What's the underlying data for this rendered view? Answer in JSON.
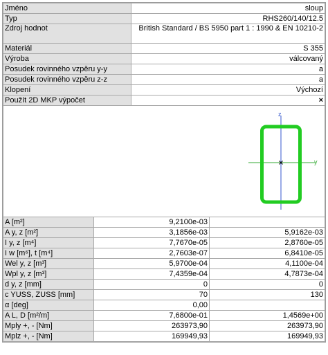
{
  "properties": [
    {
      "label": "Jméno",
      "value": "sloup"
    },
    {
      "label": "Typ",
      "value": "RHS260/140/12.5"
    },
    {
      "label": "Zdroj hodnot",
      "value": "British Standard / BS 5950 part 1 : 1990 & EN 10210-2"
    },
    {
      "label": "Materiál",
      "value": "S 355"
    },
    {
      "label": "Výroba",
      "value": "válcovaný"
    },
    {
      "label": "Posudek rovinného vzpěru y-y",
      "value": "a"
    },
    {
      "label": "Posudek rovinného vzpěru z-z",
      "value": "a"
    },
    {
      "label": "Klopení",
      "value": "Výchozí"
    },
    {
      "label": "Použít 2D MKP výpočet",
      "value": "×"
    }
  ],
  "figure": {
    "z_axis": "z",
    "y_axis": "y",
    "section_color": "#22cc22",
    "axis_color": "#33aa33",
    "z_axis_color": "#3355cc"
  },
  "table": [
    {
      "label": "A [m²]",
      "v1": "9,2100e-03",
      "v2": ""
    },
    {
      "label": "A y, z [m²]",
      "v1": "3,1856e-03",
      "v2": "5,9162e-03"
    },
    {
      "label": "I y, z [m⁴]",
      "v1": "7,7670e-05",
      "v2": "2,8760e-05"
    },
    {
      "label": "I w [m⁶], t [m⁴]",
      "v1": "2,7603e-07",
      "v2": "6,8410e-05"
    },
    {
      "label": "Wel y, z [m³]",
      "v1": "5,9700e-04",
      "v2": "4,1100e-04"
    },
    {
      "label": "Wpl y, z [m³]",
      "v1": "7,4359e-04",
      "v2": "4,7873e-04"
    },
    {
      "label": "d y, z [mm]",
      "v1": "0",
      "v2": "0"
    },
    {
      "label": "c YUSS, ZUSS [mm]",
      "v1": "70",
      "v2": "130"
    },
    {
      "label": "α [deg]",
      "v1": "0,00",
      "v2": ""
    },
    {
      "label": "A L, D [m²/m]",
      "v1": "7,6800e-01",
      "v2": "1,4569e+00"
    },
    {
      "label": "Mply +, - [Nm]",
      "v1": "263973,90",
      "v2": "263973,90"
    },
    {
      "label": "Mplz +, - [Nm]",
      "v1": "169949,93",
      "v2": "169949,93"
    }
  ]
}
